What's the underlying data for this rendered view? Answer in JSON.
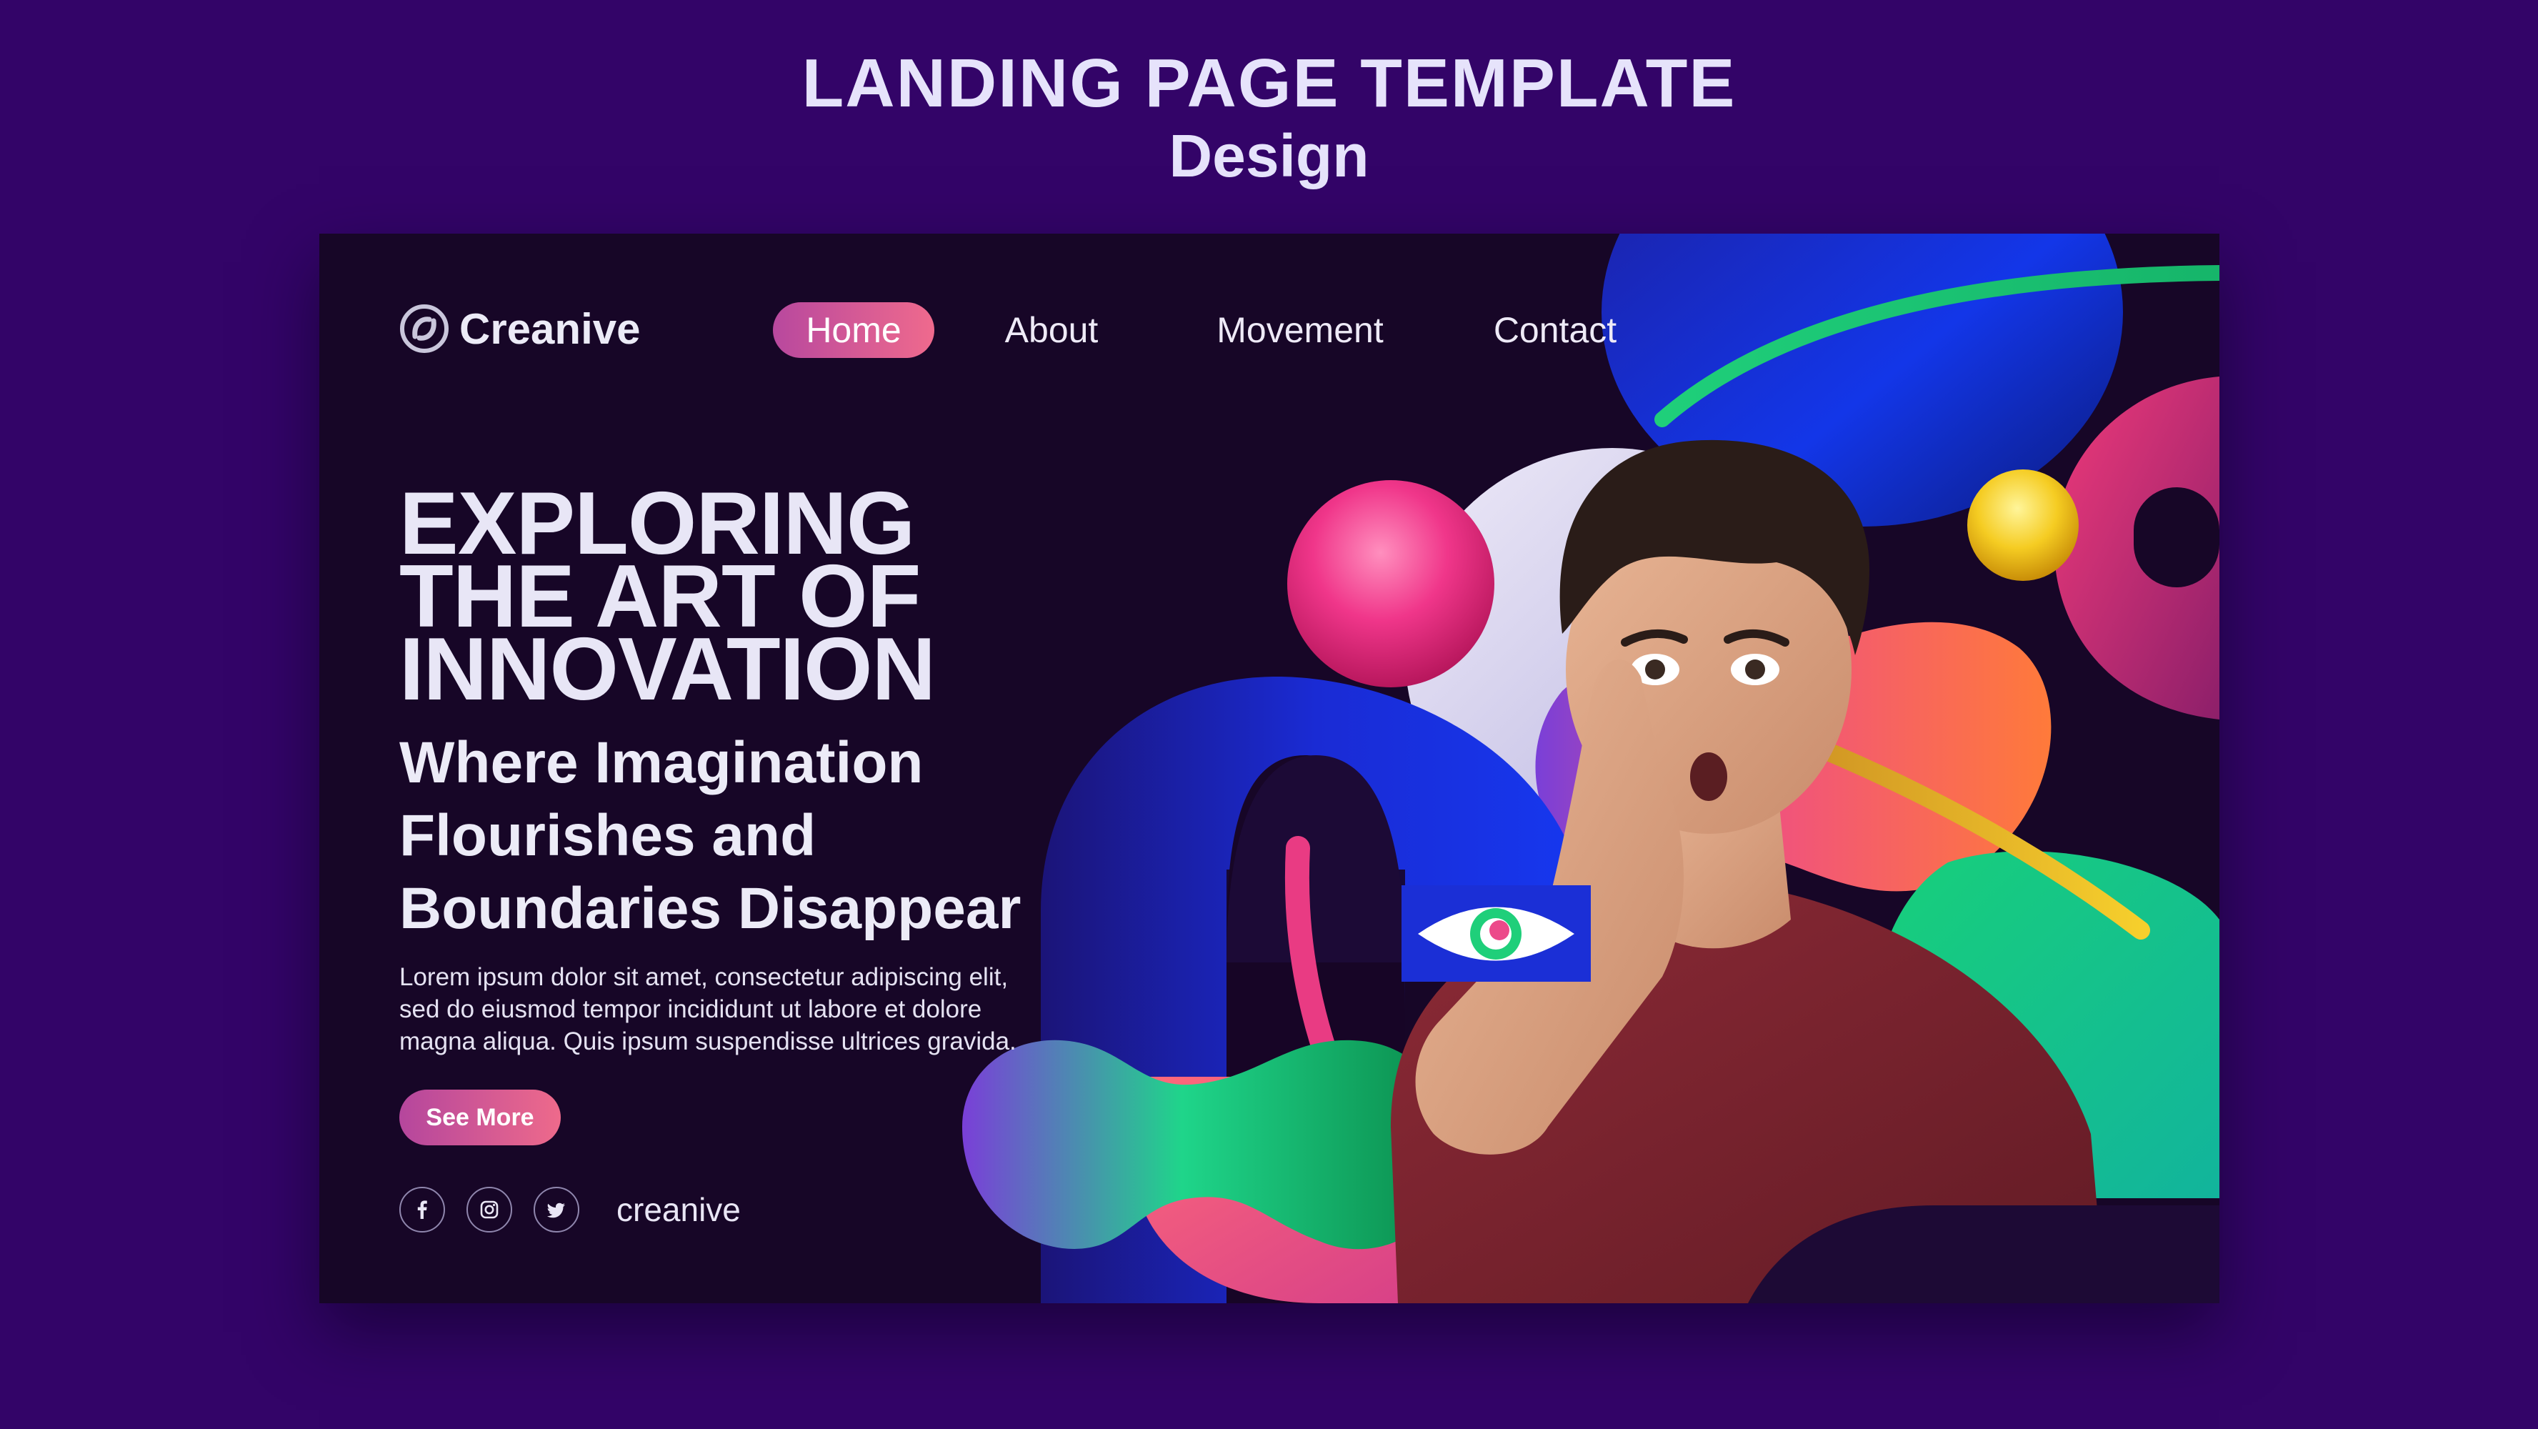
{
  "showcase": {
    "title": "LANDING PAGE TEMPLATE",
    "subtitle": "Design"
  },
  "header": {
    "logo_text": "Creanive",
    "nav": [
      {
        "label": "Home",
        "active": true
      },
      {
        "label": "About",
        "active": false
      },
      {
        "label": "Movement",
        "active": false
      },
      {
        "label": "Contact",
        "active": false
      }
    ]
  },
  "hero": {
    "heading_lines": [
      "EXPLORING",
      "THE ART OF",
      "INNOVATION"
    ],
    "subheading_lines": [
      "Where Imagination",
      "Flourishes and",
      "Boundaries Disappear"
    ],
    "body_lines": [
      "Lorem ipsum dolor sit amet, consectetur adipiscing elit,",
      "sed do eiusmod tempor incididunt ut labore et dolore",
      "magna aliqua. Quis ipsum suspendisse ultrices gravida."
    ],
    "cta_label": "See More"
  },
  "social": {
    "icons": [
      "facebook-icon",
      "instagram-icon",
      "twitter-icon"
    ],
    "handle": "creanive"
  },
  "colors": {
    "page_background": "#330468",
    "panel_background": "#170627",
    "accent_pink": "#ef6a8d",
    "accent_purple": "#b8489e",
    "heading_text": "#e8e6f6"
  }
}
